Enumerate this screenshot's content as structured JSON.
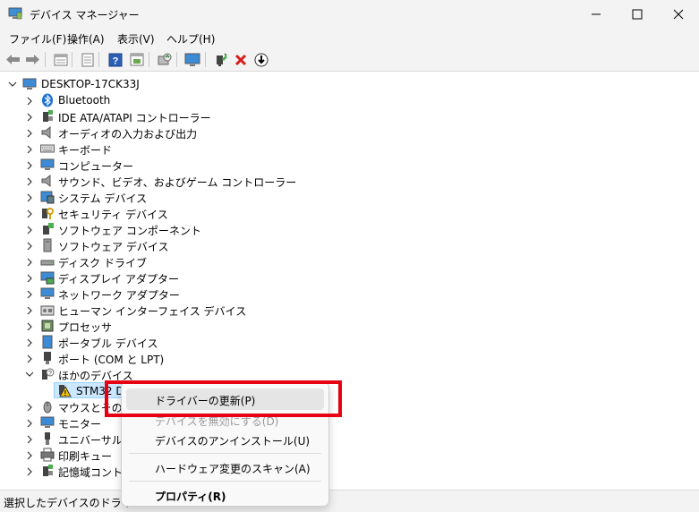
{
  "window": {
    "title": "デバイス マネージャー",
    "minimize_icon": "minimize-icon",
    "maximize_icon": "maximize-icon",
    "close_icon": "close-icon"
  },
  "menu": [
    "ファイル(F)",
    "操作(A)",
    "表示(V)",
    "ヘルプ(H)"
  ],
  "toolbar": [
    "back-arrow-icon",
    "forward-arrow-icon",
    "properties-sheet-icon",
    "list-view-icon",
    "help-icon",
    "action-view-icon",
    "scan-hardware-icon",
    "monitor-icon",
    "update-driver-icon",
    "uninstall-x-icon",
    "download-arrow-icon"
  ],
  "tree": {
    "root": "DESKTOP-17CK33J",
    "categories": [
      "Bluetooth",
      "IDE ATA/ATAPI コントローラー",
      "オーディオの入力および出力",
      "キーボード",
      "コンピューター",
      "サウンド、ビデオ、およびゲーム コントローラー",
      "システム デバイス",
      "セキュリティ デバイス",
      "ソフトウェア コンポーネント",
      "ソフトウェア デバイス",
      "ディスク ドライブ",
      "ディスプレイ アダプター",
      "ネットワーク アダプター",
      "ヒューマン インターフェイス デバイス",
      "プロセッサ",
      "ポータブル デバイス",
      "ポート (COM と LPT)",
      "ほかのデバイス",
      "STM32 DF",
      "マウスとその他",
      "モニター",
      "ユニバーサル シ",
      "印刷キュー",
      "記憶域コントロ"
    ]
  },
  "context_menu": {
    "items": [
      "ドライバーの更新(P)",
      "デバイスを無効にする(D)",
      "デバイスのアンインストール(U)",
      "ハードウェア変更のスキャン(A)",
      "プロパティ(R)"
    ]
  },
  "status_bar": "選択したデバイスのドライバー",
  "colors": {
    "highlight": "#e60012",
    "accent": "#1e6fd9"
  }
}
